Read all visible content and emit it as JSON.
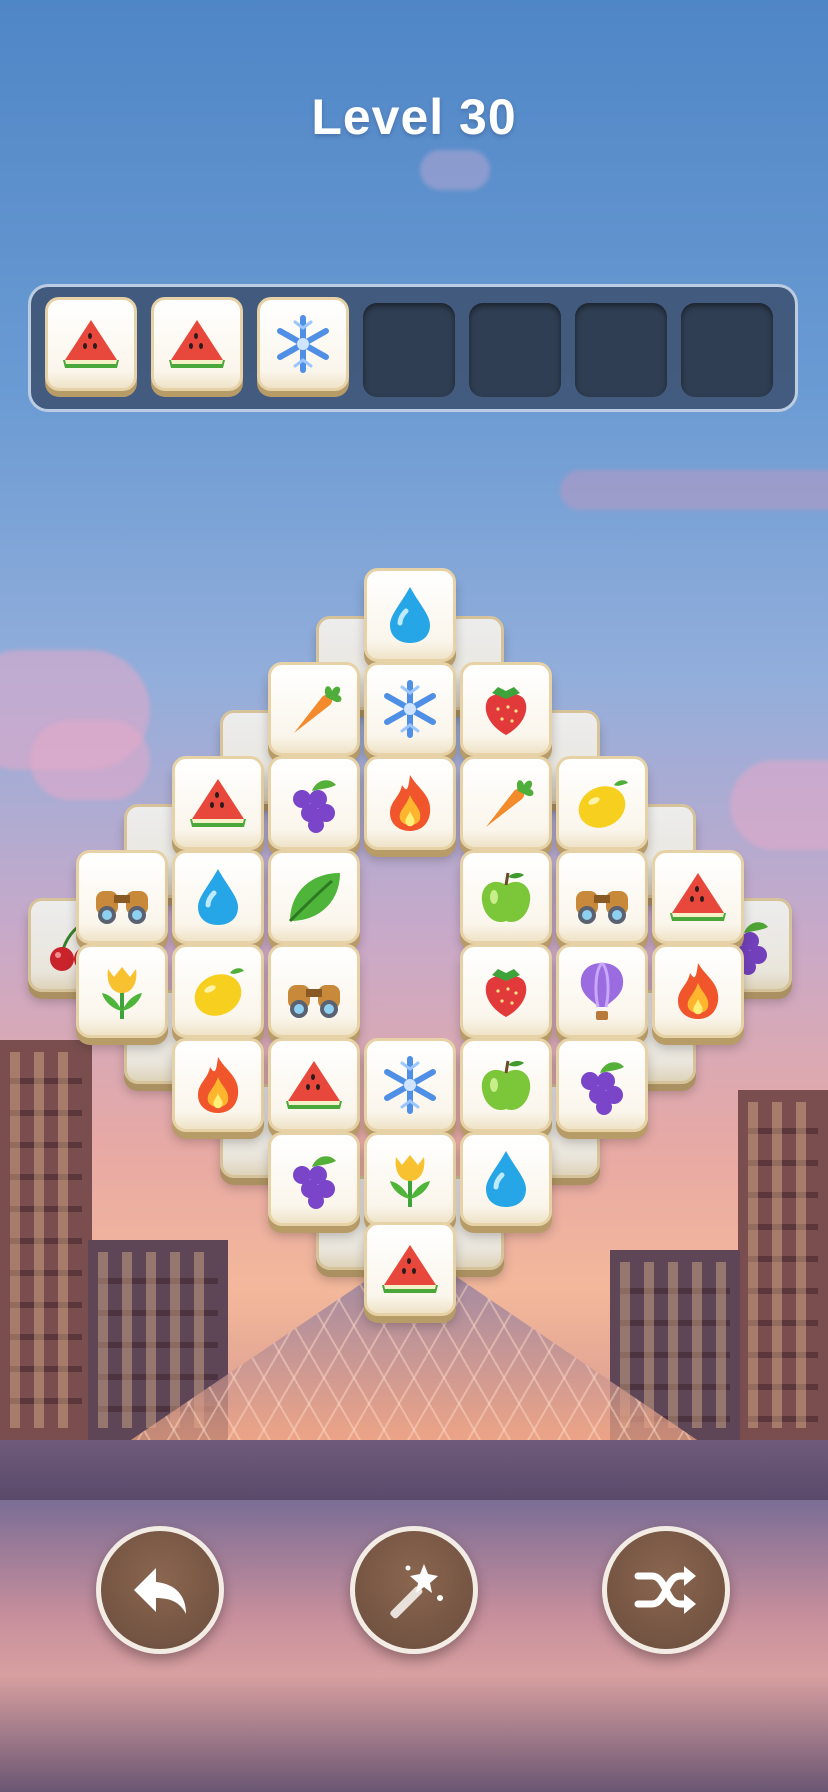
{
  "header": {
    "level_label": "Level 30"
  },
  "tray": {
    "capacity": 7,
    "slots": [
      "watermelon",
      "watermelon",
      "snowflake",
      "",
      "",
      "",
      ""
    ]
  },
  "board": {
    "tiles": [
      {
        "icon": "water-drop",
        "layer": "top"
      },
      {
        "icon": "carrot",
        "layer": "top"
      },
      {
        "icon": "snowflake",
        "layer": "top"
      },
      {
        "icon": "strawberry",
        "layer": "top"
      },
      {
        "icon": "watermelon",
        "layer": "top"
      },
      {
        "icon": "grapes",
        "layer": "top"
      },
      {
        "icon": "fire",
        "layer": "top"
      },
      {
        "icon": "carrot",
        "layer": "top"
      },
      {
        "icon": "lemon",
        "layer": "top"
      },
      {
        "icon": "binoculars",
        "layer": "top"
      },
      {
        "icon": "water-drop",
        "layer": "top"
      },
      {
        "icon": "leaf",
        "layer": "top"
      },
      {
        "icon": "apple",
        "layer": "top"
      },
      {
        "icon": "binoculars",
        "layer": "top"
      },
      {
        "icon": "watermelon",
        "layer": "top"
      },
      {
        "icon": "tulip",
        "layer": "top"
      },
      {
        "icon": "lemon",
        "layer": "top"
      },
      {
        "icon": "binoculars",
        "layer": "top"
      },
      {
        "icon": "strawberry",
        "layer": "top"
      },
      {
        "icon": "hot-air-balloon",
        "layer": "top"
      },
      {
        "icon": "fire",
        "layer": "top"
      },
      {
        "icon": "fire",
        "layer": "top"
      },
      {
        "icon": "watermelon",
        "layer": "top"
      },
      {
        "icon": "snowflake",
        "layer": "top"
      },
      {
        "icon": "apple",
        "layer": "top"
      },
      {
        "icon": "grapes",
        "layer": "top"
      },
      {
        "icon": "grapes",
        "layer": "top"
      },
      {
        "icon": "tulip",
        "layer": "top"
      },
      {
        "icon": "water-drop",
        "layer": "top"
      },
      {
        "icon": "watermelon",
        "layer": "top"
      },
      {
        "icon": "cherry",
        "layer": "under"
      },
      {
        "icon": "grapes",
        "layer": "under"
      }
    ]
  },
  "controls": {
    "undo": "undo-arrow-icon",
    "hint": "magic-wand-icon",
    "shuffle": "shuffle-icon"
  },
  "colors": {
    "tile_face": "#fbf6ec",
    "tile_edge": "#b89c68",
    "tray_bg": "#3c506e",
    "button_bg": "#6a4c3c"
  }
}
